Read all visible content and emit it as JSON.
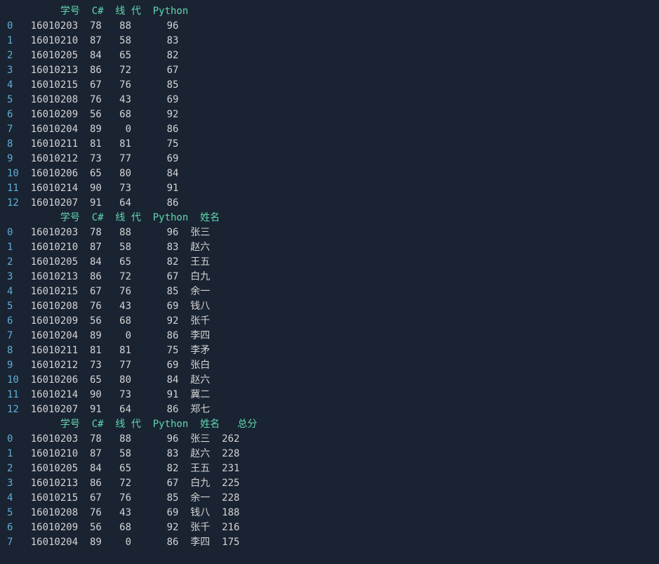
{
  "table1": {
    "header": "         学号  C#  线 代  Python",
    "rows": [
      {
        "idx": "0 ",
        "line": "  16010203  78   88      96"
      },
      {
        "idx": "1 ",
        "line": "  16010210  87   58      83"
      },
      {
        "idx": "2 ",
        "line": "  16010205  84   65      82"
      },
      {
        "idx": "3 ",
        "line": "  16010213  86   72      67"
      },
      {
        "idx": "4 ",
        "line": "  16010215  67   76      85"
      },
      {
        "idx": "5 ",
        "line": "  16010208  76   43      69"
      },
      {
        "idx": "6 ",
        "line": "  16010209  56   68      92"
      },
      {
        "idx": "7 ",
        "line": "  16010204  89    0      86"
      },
      {
        "idx": "8 ",
        "line": "  16010211  81   81      75"
      },
      {
        "idx": "9 ",
        "line": "  16010212  73   77      69"
      },
      {
        "idx": "10",
        "line": "  16010206  65   80      84"
      },
      {
        "idx": "11",
        "line": "  16010214  90   73      91"
      },
      {
        "idx": "12",
        "line": "  16010207  91   64      86"
      }
    ]
  },
  "table2": {
    "header": "         学号  C#  线 代  Python  姓名",
    "rows": [
      {
        "idx": "0 ",
        "line": "  16010203  78   88      96  张三"
      },
      {
        "idx": "1 ",
        "line": "  16010210  87   58      83  赵六"
      },
      {
        "idx": "2 ",
        "line": "  16010205  84   65      82  王五"
      },
      {
        "idx": "3 ",
        "line": "  16010213  86   72      67  白九"
      },
      {
        "idx": "4 ",
        "line": "  16010215  67   76      85  余一"
      },
      {
        "idx": "5 ",
        "line": "  16010208  76   43      69  钱八"
      },
      {
        "idx": "6 ",
        "line": "  16010209  56   68      92  张千"
      },
      {
        "idx": "7 ",
        "line": "  16010204  89    0      86  李四"
      },
      {
        "idx": "8 ",
        "line": "  16010211  81   81      75  李矛"
      },
      {
        "idx": "9 ",
        "line": "  16010212  73   77      69  张白"
      },
      {
        "idx": "10",
        "line": "  16010206  65   80      84  赵六"
      },
      {
        "idx": "11",
        "line": "  16010214  90   73      91  冀二"
      },
      {
        "idx": "12",
        "line": "  16010207  91   64      86  郑七"
      }
    ]
  },
  "table3": {
    "header": "         学号  C#  线 代  Python  姓名   总分",
    "rows": [
      {
        "idx": "0 ",
        "line": "  16010203  78   88      96  张三  262"
      },
      {
        "idx": "1 ",
        "line": "  16010210  87   58      83  赵六  228"
      },
      {
        "idx": "2 ",
        "line": "  16010205  84   65      82  王五  231"
      },
      {
        "idx": "3 ",
        "line": "  16010213  86   72      67  白九  225"
      },
      {
        "idx": "4 ",
        "line": "  16010215  67   76      85  余一  228"
      },
      {
        "idx": "5 ",
        "line": "  16010208  76   43      69  钱八  188"
      },
      {
        "idx": "6 ",
        "line": "  16010209  56   68      92  张千  216"
      },
      {
        "idx": "7 ",
        "line": "  16010204  89    0      86  李四  175"
      }
    ]
  }
}
